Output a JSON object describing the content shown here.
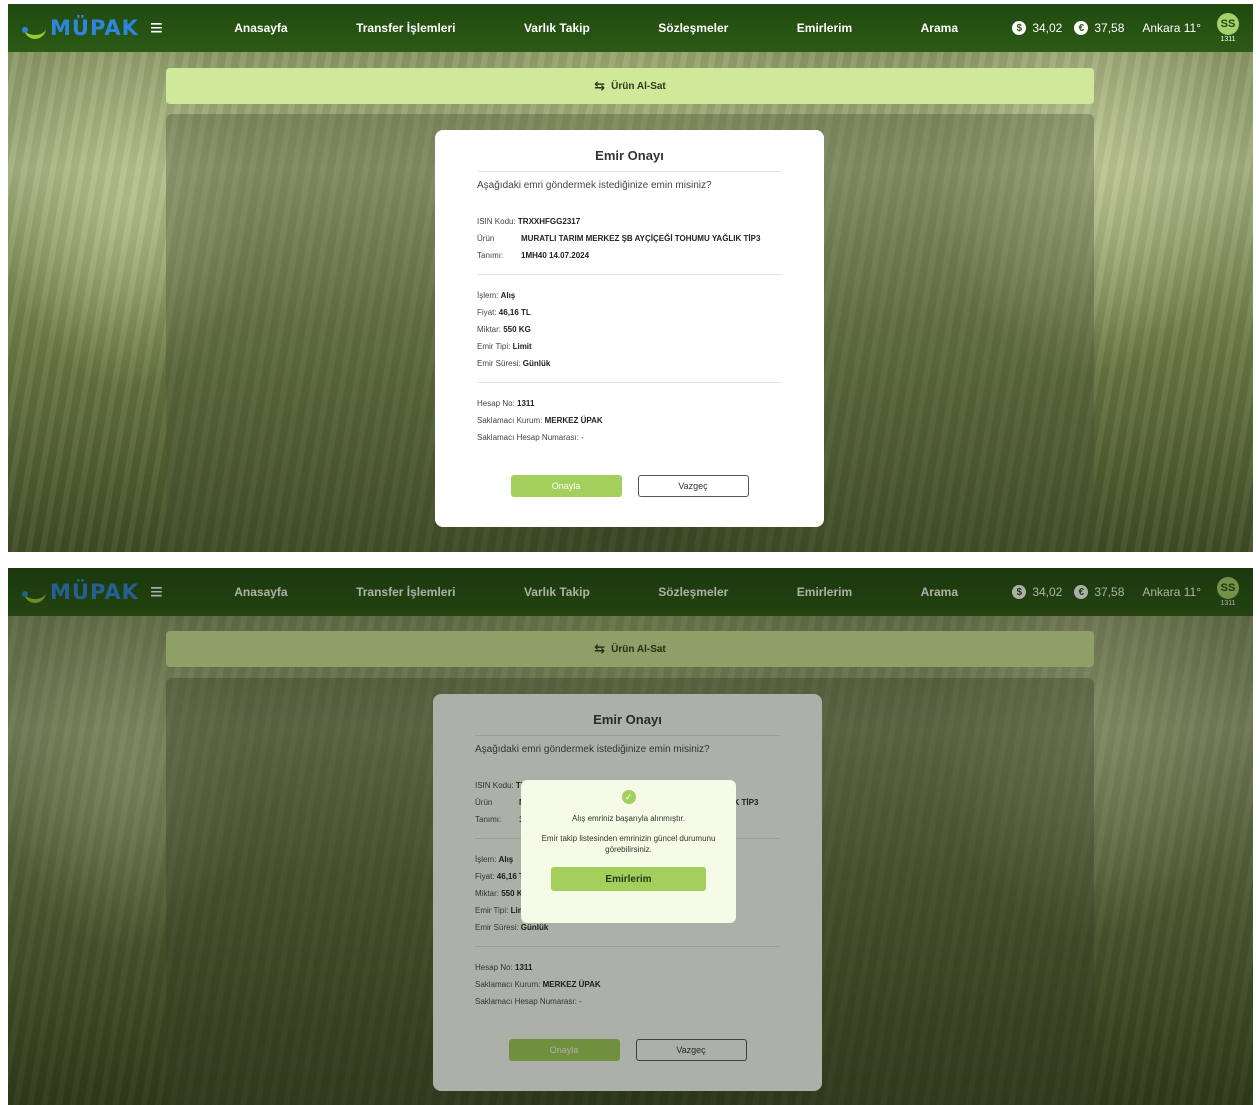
{
  "header": {
    "logo": "MÜPAK",
    "nav": [
      "Anasayfa",
      "Transfer İşlemleri",
      "Varlık Takip",
      "Sözleşmeler",
      "Emirlerim",
      "Arama"
    ],
    "usd_symbol": "$",
    "usd_rate": "34,02",
    "eur_symbol": "€",
    "eur_rate": "37,58",
    "weather": "Ankara 11°",
    "avatar_initials": "SS",
    "account": "1311"
  },
  "action_bar": {
    "label": "Ürün Al-Sat",
    "icon": "swap-arrows-icon"
  },
  "modal": {
    "title": "Emir Onayı",
    "question": "Aşağıdaki emri göndermek istediğinize emin misiniz?",
    "isin_label": "ISIN Kodu:",
    "isin_value": "TRXXHFGG2317",
    "product_label": "Ürün",
    "product_value": "MURATLI TARIM MERKEZ ŞB AYÇİÇEĞİ TOHUMU YAĞLIK TİP3",
    "desc_label": "Tanımı:",
    "desc_value": "1MH40 14.07.2024",
    "islem_label": "İşlem:",
    "islem_value": "Alış",
    "fiyat_label": "Fiyat:",
    "fiyat_value": "46,16 TL",
    "miktar_label": "Miktar:",
    "miktar_value": "550 KG",
    "emir_tipi_label": "Emir Tipi:",
    "emir_tipi_value": "Limit",
    "emir_suresi_label": "Emir Süresi:",
    "emir_suresi_value": "Günlük",
    "hesap_label": "Hesap No:",
    "hesap_value": "1311",
    "saklamaci_label": "Saklamacı Kurum:",
    "saklamaci_value": "MERKEZ ÜPAK",
    "saklamaci_hesap_label": "Saklamacı Hesap Numarası:",
    "saklamaci_hesap_value": "-",
    "confirm_label": "Onayla",
    "cancel_label": "Vazgeç"
  },
  "success": {
    "icon": "check-circle-icon",
    "message": "Alış emriniz başarıyla alınmıştır.",
    "info": "Emir takip listesinden emrinizin güncel durumunu görebilirsiniz.",
    "button_label": "Emirlerim"
  },
  "colors": {
    "header": "#2c5a15",
    "accent": "#a3cf5d",
    "action_bar": "#cfe89a",
    "logo": "#2e86de"
  }
}
